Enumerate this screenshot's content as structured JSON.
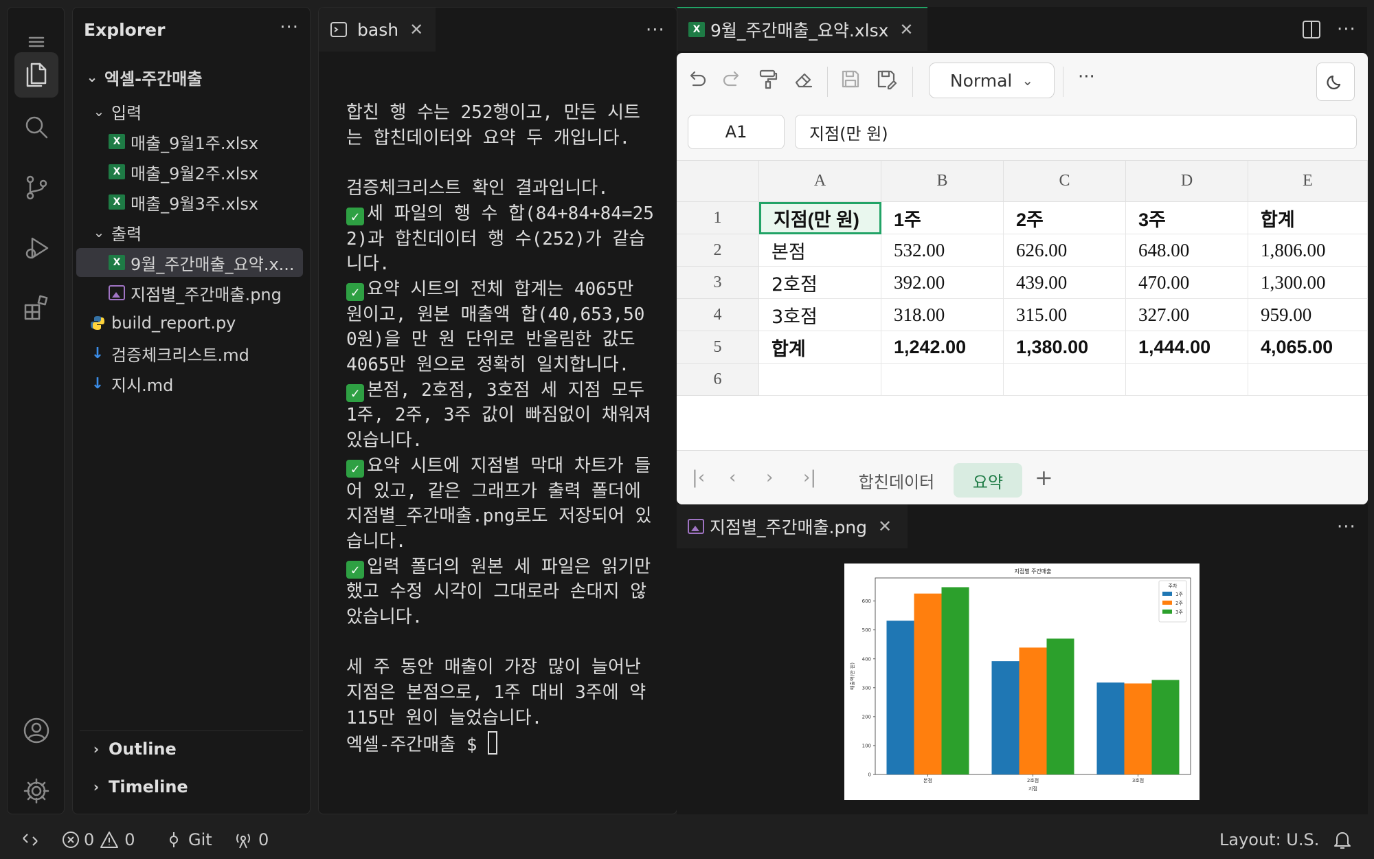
{
  "explorer": {
    "title": "Explorer",
    "more": "···",
    "tree": [
      {
        "label": "엑셀-주간매출",
        "type": "folder-root"
      },
      {
        "label": "입력",
        "type": "folder"
      },
      {
        "label": "매출_9월1주.xlsx",
        "type": "xlsx"
      },
      {
        "label": "매출_9월2주.xlsx",
        "type": "xlsx"
      },
      {
        "label": "매출_9월3주.xlsx",
        "type": "xlsx"
      },
      {
        "label": "출력",
        "type": "folder"
      },
      {
        "label": "9월_주간매출_요약.x...",
        "type": "xlsx",
        "selected": true
      },
      {
        "label": "지점별_주간매출.png",
        "type": "png"
      },
      {
        "label": "build_report.py",
        "type": "py"
      },
      {
        "label": "검증체크리스트.md",
        "type": "md"
      },
      {
        "label": "지시.md",
        "type": "md"
      }
    ],
    "sections": {
      "outline": "Outline",
      "timeline": "Timeline"
    }
  },
  "terminal": {
    "tab_label": "bash",
    "more": "···",
    "paragraphs": [
      "합친 행 수는 252행이고, 만든 시트는 합친데이터와 요약 두 개입니다.",
      "",
      "검증체크리스트 확인 결과입니다.",
      "✅ 세 파일의 행 수 합(84+84+84=252)과 합친데이터 행 수(252)가 같습니다.",
      "✅ 요약 시트의 전체 합계는 4065만 원이고, 원본 매출액 합(40,653,500원)을 만 원 단위로 반올림한 값도 4065만 원으로 정확히 일치합니다.",
      "✅ 본점, 2호점, 3호점 세 지점 모두 1주, 2주, 3주 값이 빠짐없이 채워져 있습니다.",
      "✅ 요약 시트에 지점별 막대 차트가 들어 있고, 같은 그래프가 출력 폴더에 지점별_주간매출.png로도 저장되어 있습니다.",
      "✅ 입력 폴더의 원본 세 파일은 읽기만 했고 수정 시각이 그대로라 손대지 않았습니다.",
      "",
      "세 주 동안 매출이 가장 많이 늘어난 지점은 본점으로, 1주 대비 3주에 약 115만 원이 늘었습니다."
    ],
    "prompt": "엑셀-주간매출 $ "
  },
  "spreadsheet": {
    "tab_label": "9월_주간매출_요약.xlsx",
    "style_dropdown": "Normal",
    "toolbar_more": "···",
    "name_box": "A1",
    "formula": "지점(만 원)",
    "columns": [
      "A",
      "B",
      "C",
      "D",
      "E"
    ],
    "row_numbers": [
      "1",
      "2",
      "3",
      "4",
      "5",
      "6"
    ],
    "rows": [
      [
        "지점(만 원)",
        "1주",
        "2주",
        "3주",
        "합계"
      ],
      [
        "본점",
        "532.00",
        "626.00",
        "648.00",
        "1,806.00"
      ],
      [
        "2호점",
        "392.00",
        "439.00",
        "470.00",
        "1,300.00"
      ],
      [
        "3호점",
        "318.00",
        "315.00",
        "327.00",
        "959.00"
      ],
      [
        "합계",
        "1,242.00",
        "1,380.00",
        "1,444.00",
        "4,065.00"
      ],
      [
        "",
        "",
        "",
        "",
        ""
      ]
    ],
    "sheet_tabs": [
      "합친데이터",
      "요약"
    ],
    "active_sheet": "요약",
    "add_sheet": "+"
  },
  "image_viewer": {
    "tab_label": "지점별_주간매출.png",
    "more": "···"
  },
  "chart_data": {
    "type": "bar",
    "title": "지점별 주간매출",
    "xlabel": "지점",
    "ylabel": "매출액(만 원)",
    "categories": [
      "본점",
      "2호점",
      "3호점"
    ],
    "series": [
      {
        "name": "1주",
        "values": [
          532,
          392,
          318
        ],
        "color": "#1f77b4"
      },
      {
        "name": "2주",
        "values": [
          626,
          439,
          315
        ],
        "color": "#ff7f0e"
      },
      {
        "name": "3주",
        "values": [
          648,
          470,
          327
        ],
        "color": "#2ca02c"
      }
    ],
    "legend_title": "주차",
    "legend_position": "top-right",
    "yticks": [
      0,
      100,
      200,
      300,
      400,
      500,
      600
    ],
    "ylim": [
      0,
      680
    ]
  },
  "statusbar": {
    "errors": "0",
    "warnings": "0",
    "git": "Git",
    "ports": "0",
    "layout": "Layout: U.S."
  },
  "colors": {
    "accent_green": "#21a366",
    "excel_green": "#1e7b45",
    "check_green": "#2ea043"
  }
}
